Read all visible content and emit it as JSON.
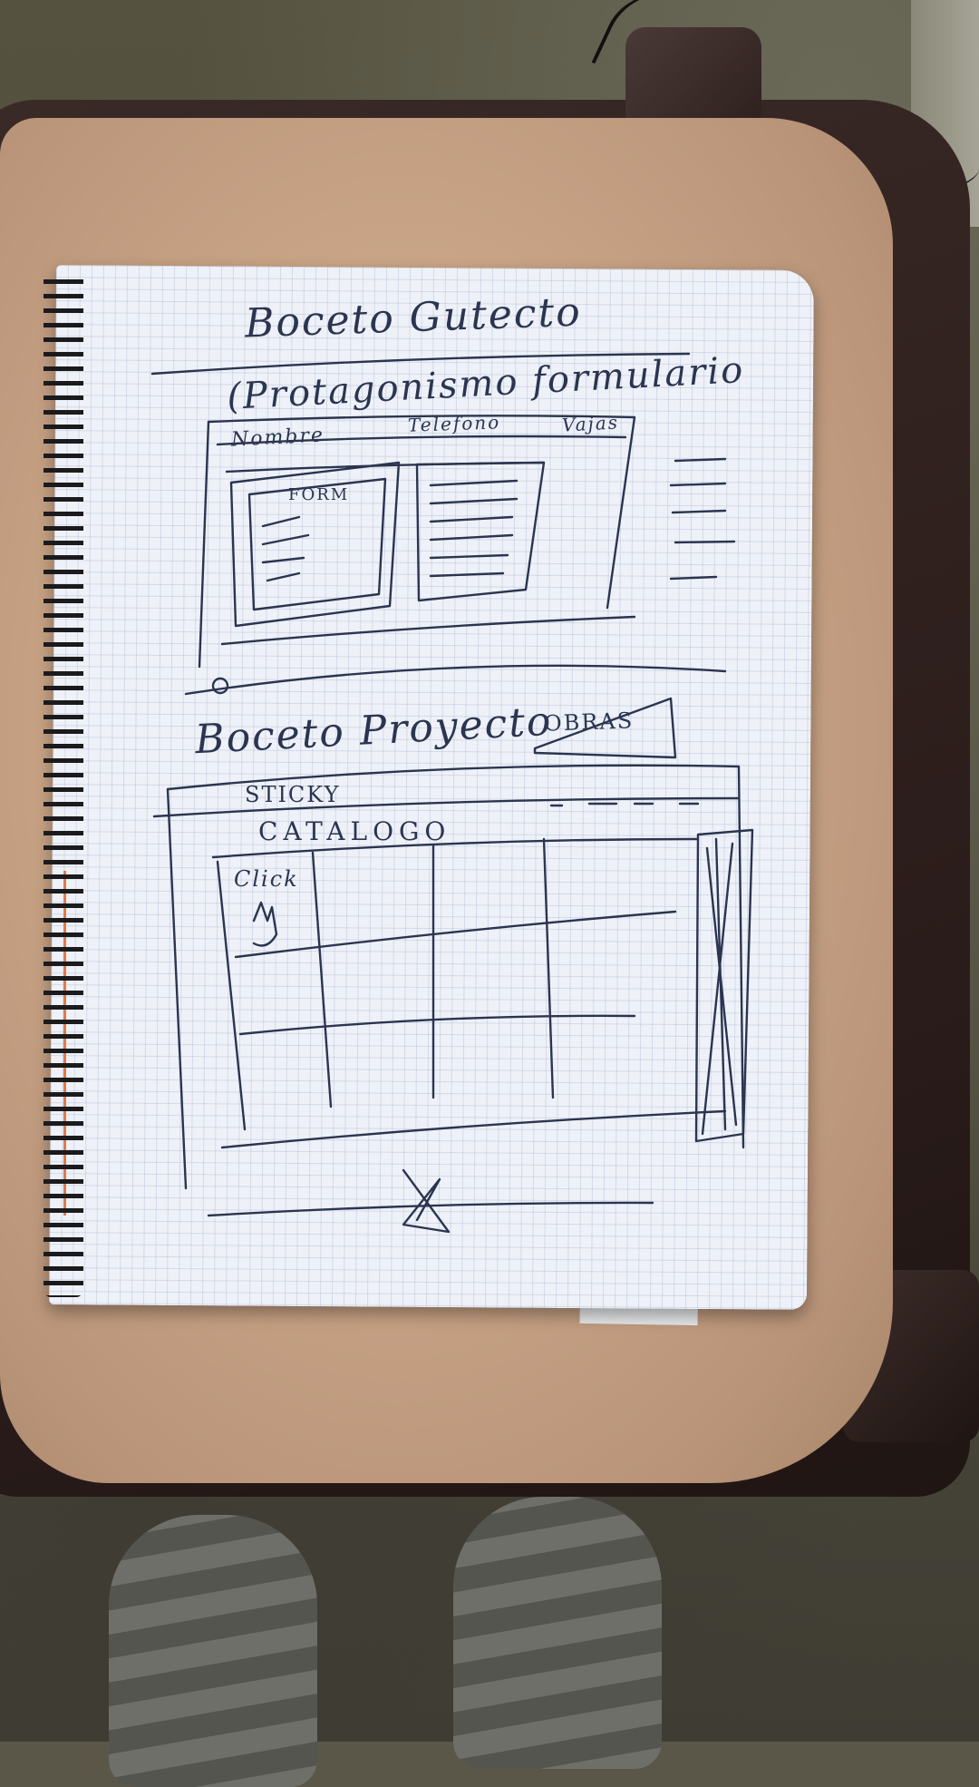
{
  "photo": {
    "description_tag": "photo of hand-drawn wireframe sketches in a grid notebook on a chair",
    "colors": {
      "paper": "#eef1f8",
      "ink": "#2b3550",
      "seat": "#c9a486",
      "frame": "#2a1c1a"
    }
  },
  "sketch_top": {
    "title": "Boceto Gutecto",
    "subtitle": "(Protagonismo formulario",
    "nav_left": "Nombre",
    "nav_mid": "Telefono",
    "nav_right": "Vajas",
    "form_label": "FORM"
  },
  "sketch_bottom": {
    "title": "Boceto Proyecto",
    "badge": "OBRAS",
    "sticky_label": "STICKY",
    "catalog_label": "CATALOGO",
    "click_label": "Click"
  }
}
